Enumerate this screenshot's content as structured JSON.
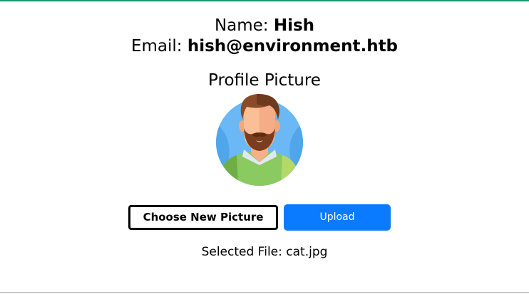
{
  "profile": {
    "name_label": "Name:",
    "name_value": "Hish",
    "email_label": "Email:",
    "email_value": "hish@environment.htb"
  },
  "picture_section": {
    "title": "Profile Picture",
    "avatar_icon": "man-avatar-icon"
  },
  "actions": {
    "choose_label": "Choose New Picture",
    "upload_label": "Upload"
  },
  "status": {
    "selected_file_label": "Selected File:",
    "selected_file_value": "cat.jpg"
  },
  "colors": {
    "top_accent": "#1a9b6c",
    "upload_button": "#0a7bff",
    "avatar_background": "#6ab8f5"
  }
}
